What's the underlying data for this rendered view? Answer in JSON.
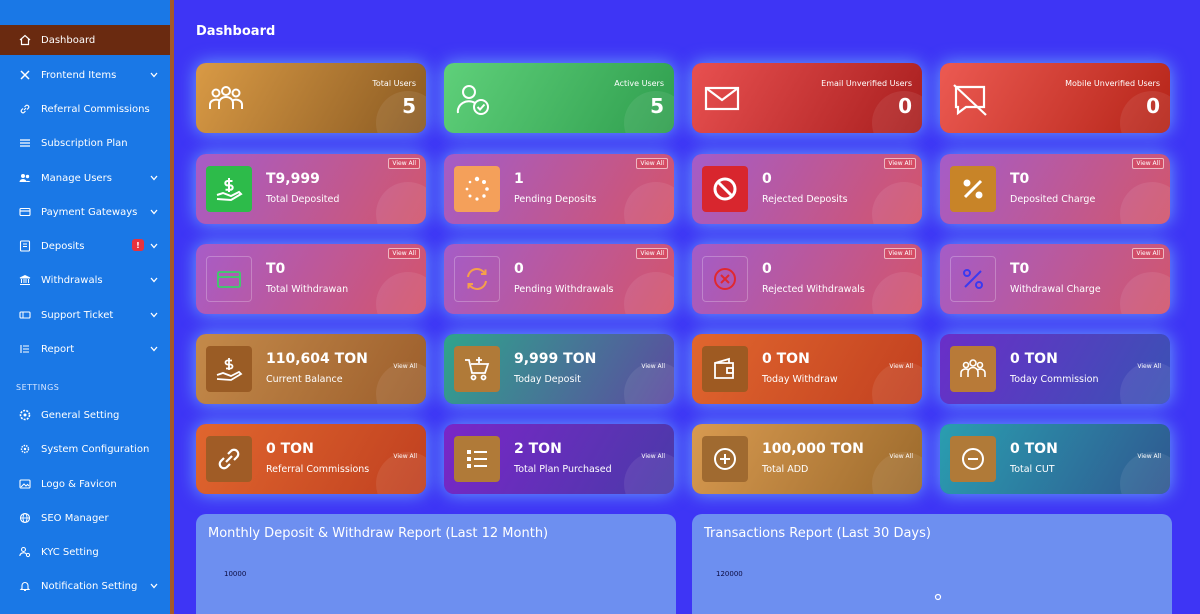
{
  "sidebar": {
    "items": [
      {
        "label": "Dashboard",
        "icon": "home-icon"
      },
      {
        "label": "Frontend Items",
        "icon": "tools-icon"
      },
      {
        "label": "Referral Commissions",
        "icon": "link-icon"
      },
      {
        "label": "Subscription Plan",
        "icon": "list-icon"
      },
      {
        "label": "Manage Users",
        "icon": "users-icon"
      },
      {
        "label": "Payment Gateways",
        "icon": "card-icon"
      },
      {
        "label": "Deposits",
        "icon": "wallet-icon",
        "badge": "!"
      },
      {
        "label": "Withdrawals",
        "icon": "bank-icon"
      },
      {
        "label": "Support Ticket",
        "icon": "ticket-icon"
      },
      {
        "label": "Report",
        "icon": "report-icon"
      }
    ],
    "settings_heading": "SETTINGS",
    "settings": [
      {
        "label": "General Setting",
        "icon": "gear-icon"
      },
      {
        "label": "System Configuration",
        "icon": "cog-icon"
      },
      {
        "label": "Logo & Favicon",
        "icon": "image-icon"
      },
      {
        "label": "SEO Manager",
        "icon": "globe-icon"
      },
      {
        "label": "KYC Setting",
        "icon": "user-cog-icon"
      },
      {
        "label": "Notification Setting",
        "icon": "bell-icon"
      }
    ]
  },
  "page": {
    "title": "Dashboard"
  },
  "cards_row1": [
    {
      "label": "Total Users",
      "value": "5",
      "icon": "users-group-icon"
    },
    {
      "label": "Active Users",
      "value": "5",
      "icon": "user-check-icon"
    },
    {
      "label": "Email Unverified Users",
      "value": "0",
      "icon": "envelope-icon"
    },
    {
      "label": "Mobile Unverified Users",
      "value": "0",
      "icon": "message-slash-icon"
    }
  ],
  "cards_row2": [
    {
      "value": "T9,999",
      "label": "Total Deposited",
      "icon": "hand-dollar-icon",
      "link": "View All"
    },
    {
      "value": "1",
      "label": "Pending Deposits",
      "icon": "spinner-icon",
      "link": "View All"
    },
    {
      "value": "0",
      "label": "Rejected Deposits",
      "icon": "ban-icon",
      "link": "View All"
    },
    {
      "value": "T0",
      "label": "Deposited Charge",
      "icon": "percent-icon",
      "link": "View All"
    }
  ],
  "cards_row3": [
    {
      "value": "T0",
      "label": "Total Withdrawan",
      "icon": "card-outline-icon",
      "link": "View All"
    },
    {
      "value": "0",
      "label": "Pending Withdrawals",
      "icon": "sync-icon",
      "link": "View All"
    },
    {
      "value": "0",
      "label": "Rejected Withdrawals",
      "icon": "times-circle-icon",
      "link": "View All"
    },
    {
      "value": "T0",
      "label": "Withdrawal Charge",
      "icon": "percent-outline-icon",
      "link": "View All"
    }
  ],
  "cards_row4": [
    {
      "value": "110,604 TON",
      "label": "Current Balance",
      "icon": "hand-dollar-icon",
      "link": "View All"
    },
    {
      "value": "9,999 TON",
      "label": "Today Deposit",
      "icon": "cart-plus-icon",
      "link": "View All"
    },
    {
      "value": "0 TON",
      "label": "Today Withdraw",
      "icon": "wallet-icon",
      "link": "View All"
    },
    {
      "value": "0 TON",
      "label": "Today Commission",
      "icon": "users-group-icon",
      "link": "View All"
    }
  ],
  "cards_row5": [
    {
      "value": "0 TON",
      "label": "Referral Commissions",
      "icon": "link-icon",
      "link": "View All"
    },
    {
      "value": "2 TON",
      "label": "Total Plan Purchased",
      "icon": "list-check-icon",
      "link": "View All"
    },
    {
      "value": "100,000 TON",
      "label": "Total ADD",
      "icon": "plus-circle-icon",
      "link": "View All"
    },
    {
      "value": "0 TON",
      "label": "Total CUT",
      "icon": "minus-circle-icon",
      "link": "View All"
    }
  ],
  "colors": {
    "background": "#3e35f5",
    "sidebar": "#1a78e6",
    "sidebar_active": "#6a2a10"
  },
  "charts": [
    {
      "title": "Monthly Deposit & Withdraw Report (Last 12 Month)",
      "y_tick": "10000"
    },
    {
      "title": "Transactions Report (Last 30 Days)",
      "y_tick": "120000"
    }
  ]
}
